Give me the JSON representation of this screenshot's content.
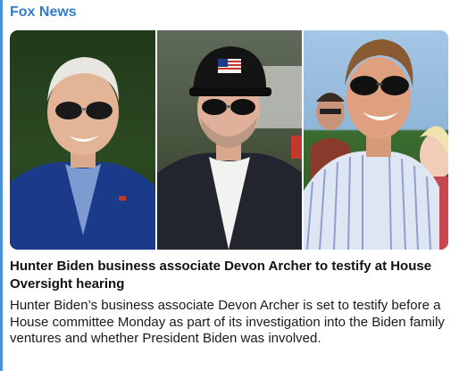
{
  "card": {
    "source": "Fox News",
    "headline": "Hunter Biden business associate Devon Archer to testify at House Oversight hearing",
    "summary": "Hunter Biden’s business associate Devon Archer is set to testify before a House committee Monday as part of its investigation into the Biden family ventures and whether President Biden was involved."
  },
  "colors": {
    "accent": "#4a90d9",
    "source_text": "#2f7dc8",
    "headline_text": "#111111"
  },
  "images": [
    {
      "name": "photo-man-sunglasses-blue-blazer"
    },
    {
      "name": "photo-man-cap-sunglasses-dark-blazer"
    },
    {
      "name": "photo-man-sunglasses-striped-shirt"
    }
  ]
}
